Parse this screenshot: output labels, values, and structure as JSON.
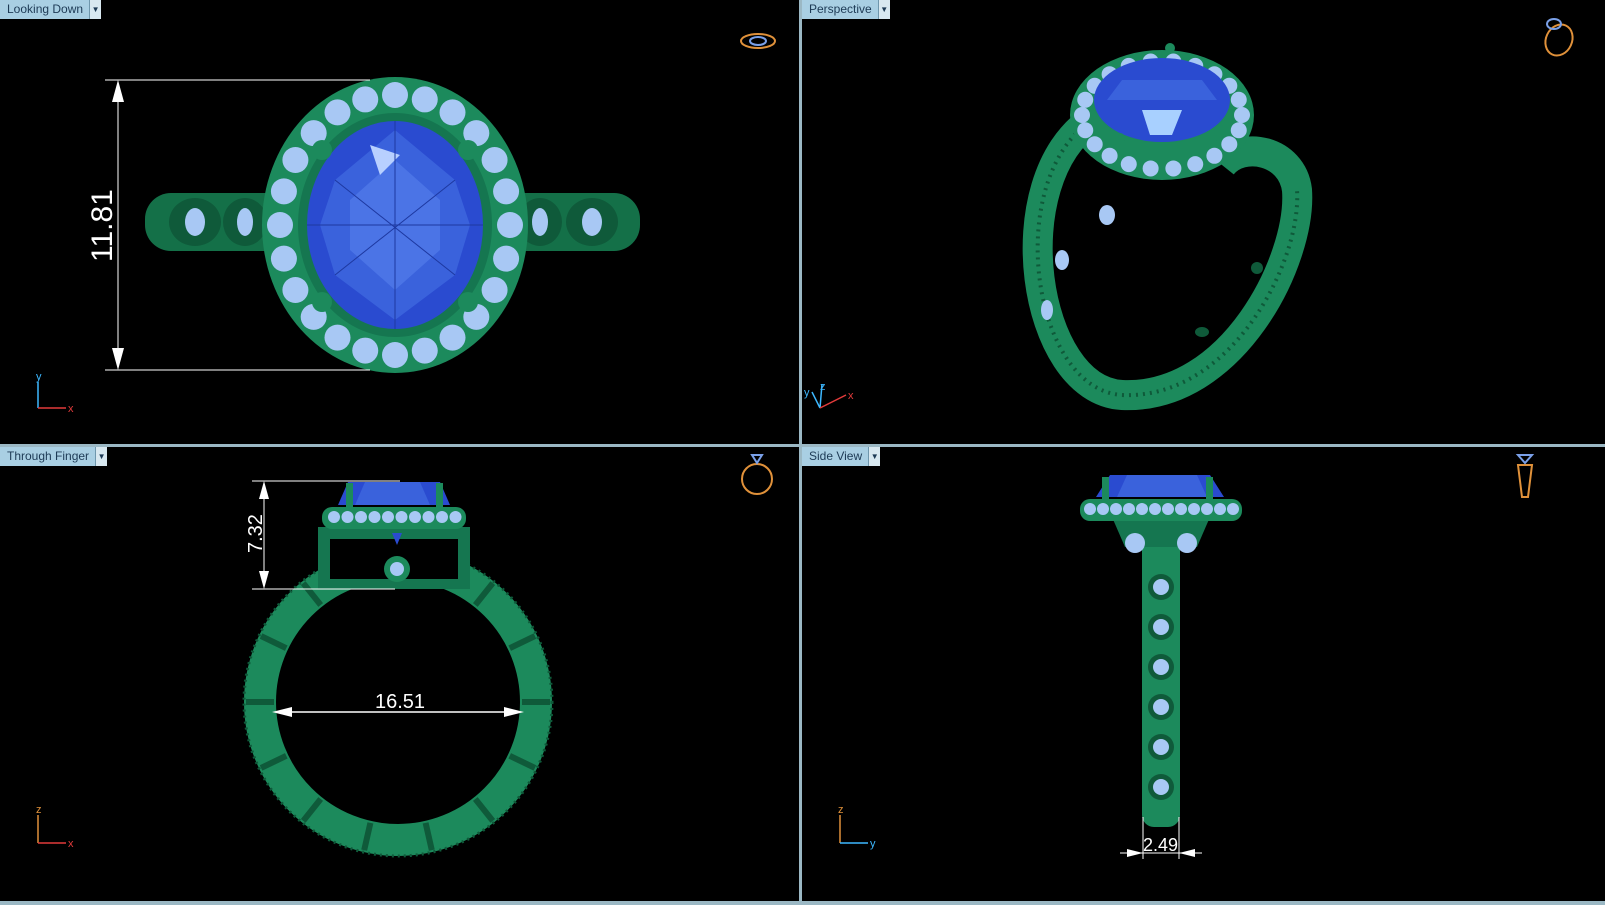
{
  "viewports": [
    {
      "title": "Looking Down",
      "axes": [
        "y",
        "x"
      ],
      "dimension": "11.81"
    },
    {
      "title": "Perspective",
      "axes": [
        "y",
        "z",
        "x"
      ]
    },
    {
      "title": "Through Finger",
      "axes": [
        "z",
        "x"
      ],
      "dimensions": [
        "7.32",
        "16.51"
      ]
    },
    {
      "title": "Side View",
      "axes": [
        "z",
        "y"
      ],
      "dimension": "2.49"
    }
  ],
  "colors": {
    "metal": "#1c8a5c",
    "metal_dark": "#0f5a3a",
    "gem": "#2a4bd0",
    "gem_light": "#5c85f0",
    "accent_stone": "#a8c8f4",
    "viewport_bg": "#000000",
    "frame": "#9bb8c4",
    "tab": "#a9cfe3",
    "orientation_icon": "#e0913a"
  },
  "icons": [
    "dropdown-arrow-icon",
    "axis-indicator-icon",
    "ring-orientation-icon"
  ]
}
